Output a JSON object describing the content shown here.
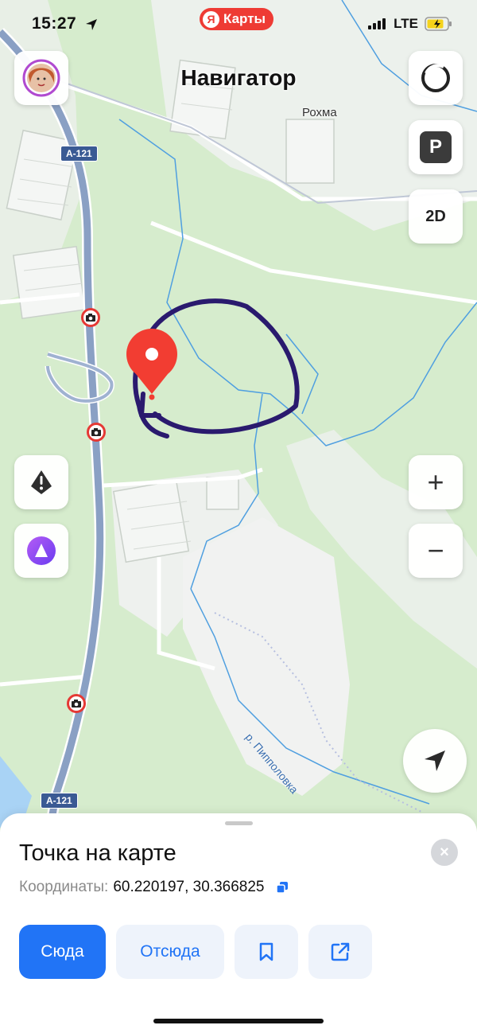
{
  "status_bar": {
    "time": "15:27",
    "network": "LTE"
  },
  "header": {
    "brand": "Карты",
    "brand_logo": "Я",
    "title": "Навигатор"
  },
  "map": {
    "place_label": "Рохма",
    "road_badges": [
      "A-121",
      "A-121"
    ],
    "river_label": "р. Пипполовка"
  },
  "controls": {
    "layers_icon": "layers-circle-icon",
    "parking_label": "P",
    "view_mode_label": "2D",
    "zoom_in_label": "+",
    "zoom_out_label": "−"
  },
  "sheet": {
    "title": "Точка на карте",
    "close_label": "×",
    "coords_label": "Координаты:",
    "coords_value": "60.220197, 30.366825",
    "actions": {
      "to_here": "Сюда",
      "from_here": "Отсюда"
    }
  },
  "colors": {
    "accent": "#2174f6",
    "brand": "#ee3b34",
    "pin": "#f23d32",
    "annotation": "#2a1a6e",
    "forest": "#d6eccd",
    "road": "#8aa0c4"
  }
}
